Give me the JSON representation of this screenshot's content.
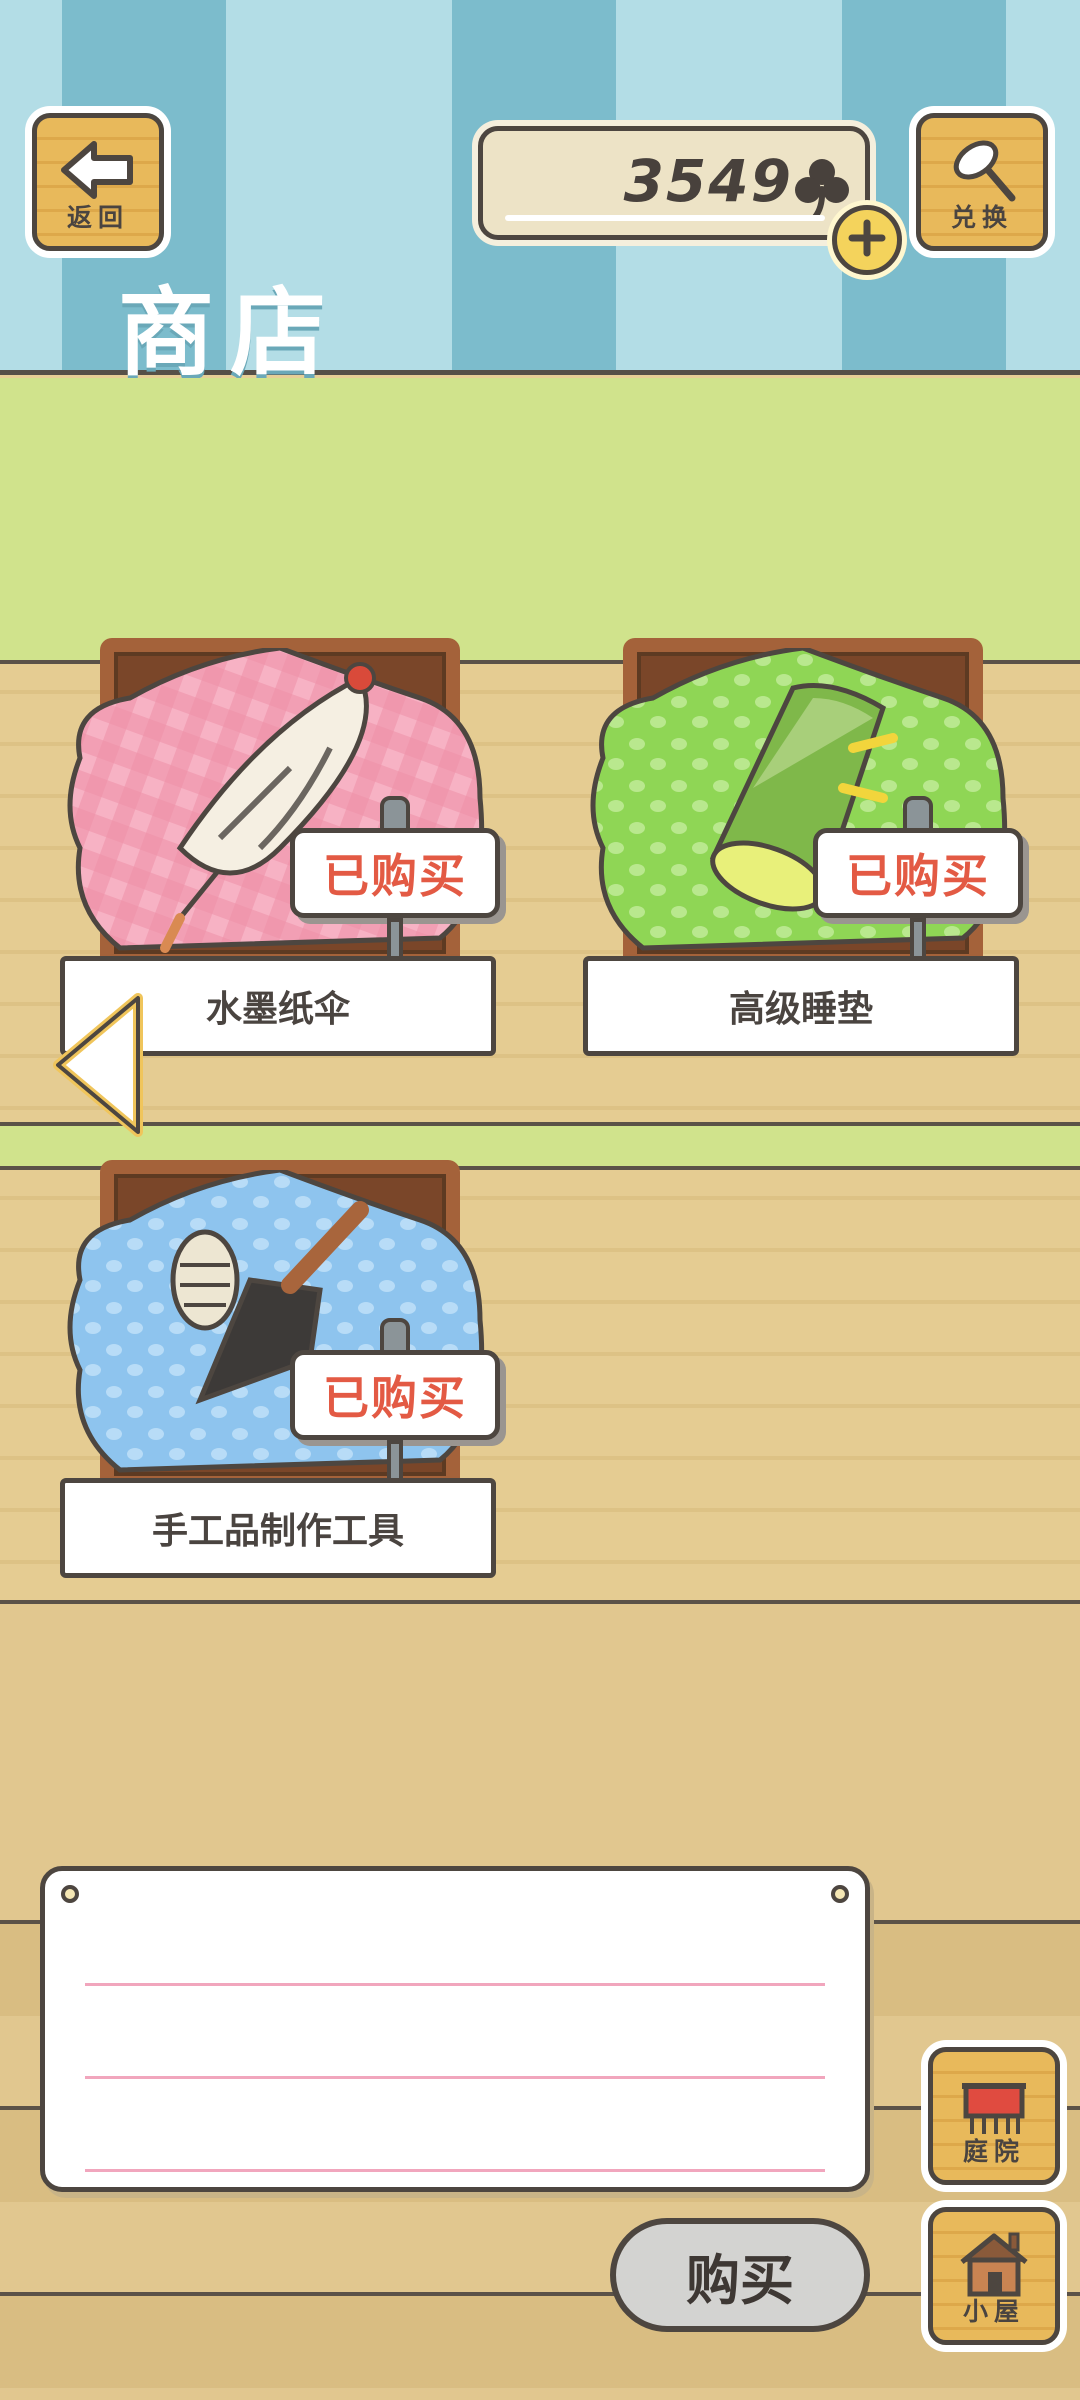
{
  "header": {
    "title": "商店",
    "back_label": "返回",
    "exchange_label": "兑换",
    "coins": "3549"
  },
  "shop": {
    "items": [
      {
        "name": "水墨纸伞",
        "status": "已购买",
        "cloth_color": "#f49cb4"
      },
      {
        "name": "高级睡垫",
        "status": "已购买",
        "cloth_color": "#8fd655"
      },
      {
        "name": "手工品制作工具",
        "status": "已购买",
        "cloth_color": "#8ec4ee"
      }
    ]
  },
  "description": "",
  "footer": {
    "buy_label": "购买",
    "yard_label": "庭院",
    "house_label": "小屋"
  },
  "colors": {
    "sold_text": "#e35a44",
    "awning_dark": "#7cbccc",
    "awning_light": "#b3dde6",
    "grass": "#d0e38c",
    "wood": "#e5cc92"
  },
  "icons": [
    "back-arrow-icon",
    "clover-icon",
    "plus-icon",
    "exchange-net-icon",
    "left-arrow-icon",
    "yard-gate-icon",
    "house-icon"
  ]
}
